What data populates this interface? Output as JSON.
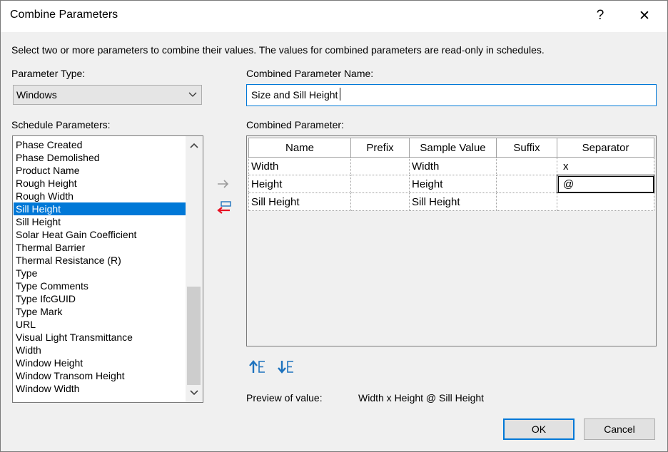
{
  "window": {
    "title": "Combine Parameters",
    "help_glyph": "?",
    "close_glyph": "✕"
  },
  "instructions": "Select two or more parameters to combine their values.  The values for combined parameters are read-only in schedules.",
  "parameter_type": {
    "label": "Parameter Type:",
    "selected": "Windows"
  },
  "schedule_parameters": {
    "label": "Schedule Parameters:",
    "items": [
      "Phase Created",
      "Phase Demolished",
      "Product Name",
      "Rough Height",
      "Rough Width",
      "Sill Height",
      "Sill Height",
      "Solar Heat Gain Coefficient",
      "Thermal Barrier",
      "Thermal Resistance (R)",
      "Type",
      "Type Comments",
      "Type IfcGUID",
      "Type Mark",
      "URL",
      "Visual Light Transmittance",
      "Width",
      "Window Height",
      "Window Transom Height",
      "Window Width"
    ],
    "selected_index": 5
  },
  "combined_name": {
    "label": "Combined Parameter Name:",
    "value": "Size and Sill Height"
  },
  "combined_parameter": {
    "label": "Combined Parameter:",
    "columns": [
      "Name",
      "Prefix",
      "Sample Value",
      "Suffix",
      "Separator"
    ],
    "rows": [
      {
        "name": "Width",
        "prefix": "",
        "sample": "Width",
        "suffix": "",
        "separator": "x"
      },
      {
        "name": "Height",
        "prefix": "",
        "sample": "Height",
        "suffix": "",
        "separator": "@"
      },
      {
        "name": "Sill Height",
        "prefix": "",
        "sample": "Sill Height",
        "suffix": "",
        "separator": ""
      }
    ]
  },
  "preview": {
    "label": "Preview of value:",
    "value": "Width x Height @ Sill Height"
  },
  "buttons": {
    "ok": "OK",
    "cancel": "Cancel"
  },
  "colors": {
    "selection": "#0078d7",
    "dialog_bg": "#f0f0f0",
    "remove_arrow": "#e81123",
    "move_icon": "#1e73be"
  }
}
